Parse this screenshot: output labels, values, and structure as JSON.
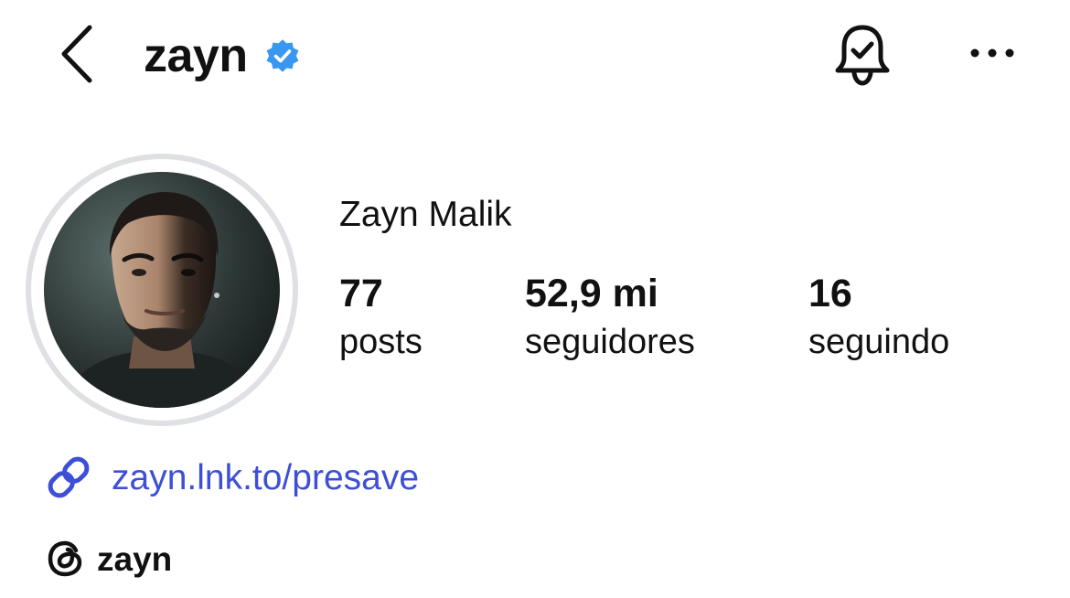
{
  "header": {
    "username": "zayn",
    "back_icon": "chevron-left-icon",
    "verified_icon": "verified-badge-icon",
    "notifications_icon": "bell-check-icon",
    "more_icon": "more-horizontal-icon"
  },
  "profile": {
    "full_name": "Zayn Malik",
    "stats": {
      "posts": {
        "value": "77",
        "label": "posts"
      },
      "followers": {
        "value": "52,9 mi",
        "label": "seguidores"
      },
      "following": {
        "value": "16",
        "label": "seguindo"
      }
    },
    "link": {
      "icon": "link-icon",
      "text": "zayn.lnk.to/presave"
    },
    "threads": {
      "icon": "threads-icon",
      "text": "zayn"
    }
  },
  "colors": {
    "verified_blue": "#3897f0",
    "link_blue": "#3d4fd6",
    "avatar_ring": "#dfe0e4"
  }
}
